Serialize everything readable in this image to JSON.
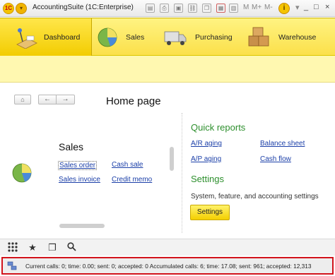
{
  "window": {
    "title": "AccountingSuite  (1C:Enterprise)",
    "logo_text": "1C",
    "toolbar_labels": [
      "M",
      "M+",
      "M-"
    ],
    "info_label": "i",
    "minimize": "_",
    "restore": "□",
    "close": "×"
  },
  "sections": [
    {
      "label": "Dashboard",
      "icon": "dashboard-icon",
      "active": true
    },
    {
      "label": "Sales",
      "icon": "sales-pie-icon",
      "active": false
    },
    {
      "label": "Purchasing",
      "icon": "truck-icon",
      "active": false
    },
    {
      "label": "Warehouse",
      "icon": "boxes-icon",
      "active": false
    }
  ],
  "navigation": {
    "home": "⌂",
    "back": "←",
    "forward": "→",
    "page_title": "Home page"
  },
  "sales_panel": {
    "title": "Sales",
    "links": {
      "sales_order": "Sales order",
      "cash_sale": "Cash sale",
      "sales_invoice": "Sales invoice",
      "credit_memo": "Credit memo"
    }
  },
  "quick_reports": {
    "title": "Quick reports",
    "links": {
      "ar_aging": "A/R aging",
      "balance_sheet": "Balance sheet",
      "ap_aging": "A/P aging",
      "cash_flow": "Cash flow"
    }
  },
  "settings": {
    "title": "Settings",
    "description": "System, feature, and accounting settings",
    "button": "Settings"
  },
  "tools": [
    "grid-icon",
    "star-icon",
    "history-icon",
    "search-icon"
  ],
  "status": {
    "text": "Current calls: 0; time: 0.00; sent: 0; accepted: 0    Accumulated calls: 6; time: 17.08; sent: 961; accepted: 12,313"
  },
  "colors": {
    "section_bg": "#fbe04a",
    "link": "#1b3fa8",
    "green_title": "#2d8f2d",
    "status_border": "#d2131b"
  }
}
